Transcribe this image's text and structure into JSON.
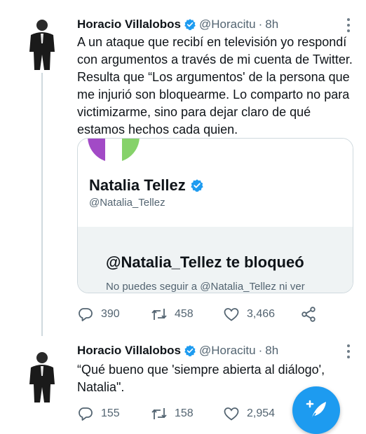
{
  "tweets": [
    {
      "name": "Horacio Villalobos",
      "handle": "@Horacitu",
      "time": "8h",
      "text": "A un ataque que recibí en televisión yo respondí con argumentos a través de mi cuenta de Twitter. Resulta que “Los argumentos' de la persona que me injurió son bloquearme. Lo comparto no para victimizarme, sino para dejar claro de qué estamos hechos cada quien.",
      "card": {
        "name": "Natalia Tellez",
        "handle": "@Natalia_Tellez",
        "block_title": "@Natalia_Tellez te bloqueó",
        "block_sub": "No puedes seguir a @Natalia_Tellez ni ver"
      },
      "replies": "390",
      "retweets": "458",
      "likes": "3,466"
    },
    {
      "name": "Horacio Villalobos",
      "handle": "@Horacitu",
      "time": "8h",
      "text": "“Qué bueno que 'siempre abierta al diálogo', Natalia\".",
      "replies": "155",
      "retweets": "158",
      "likes": "2,954"
    }
  ],
  "separator": "·",
  "icons": {
    "verified": "verified-badge-icon",
    "more": "more-options-icon",
    "reply": "reply-icon",
    "retweet": "retweet-icon",
    "like": "heart-icon",
    "share": "share-icon",
    "compose": "compose-tweet-icon"
  },
  "colors": {
    "accent": "#1d9bf0",
    "secondary_text": "#536471"
  }
}
